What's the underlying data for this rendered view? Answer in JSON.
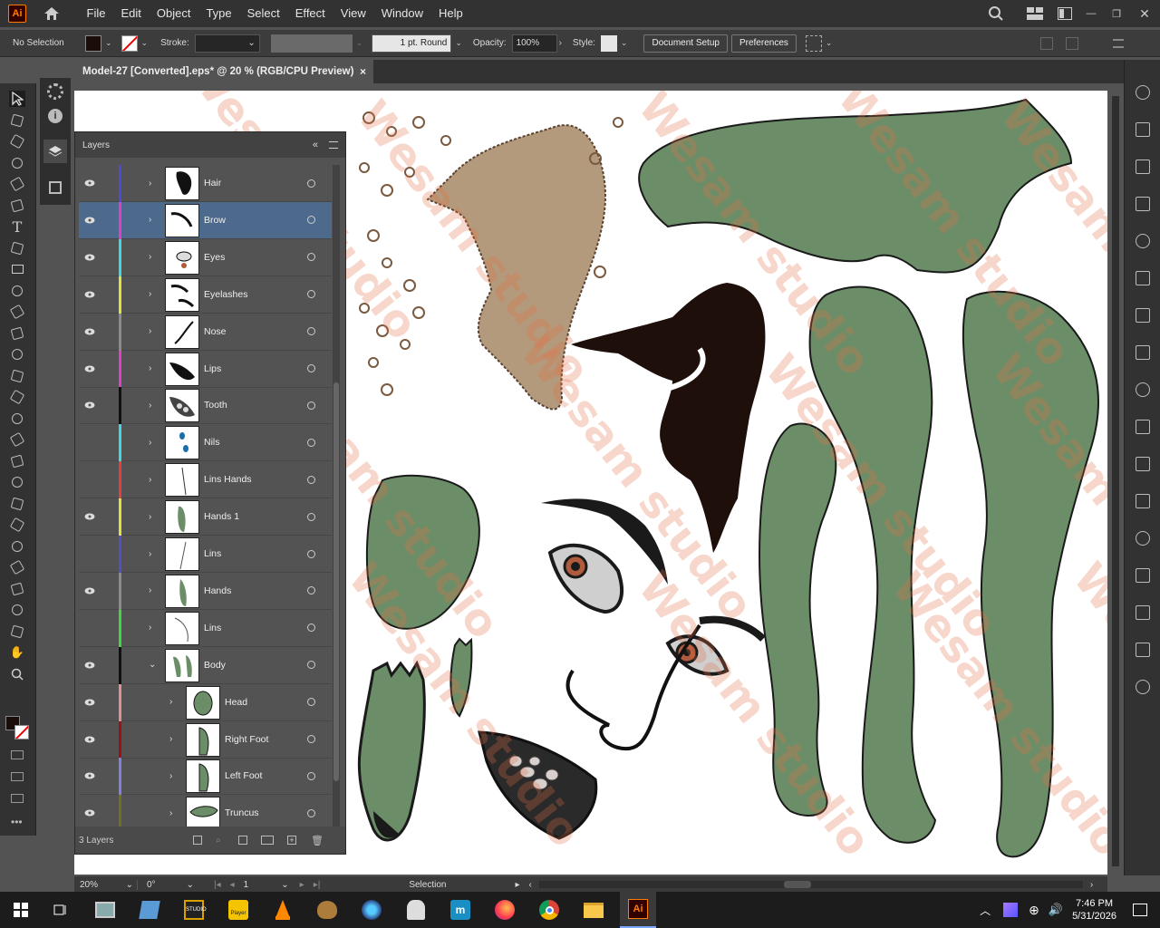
{
  "app": {
    "logo": "Ai"
  },
  "menu": [
    "File",
    "Edit",
    "Object",
    "Type",
    "Select",
    "Effect",
    "View",
    "Window",
    "Help"
  ],
  "control": {
    "selection": "No Selection",
    "stroke_label": "Stroke:",
    "brush": "1 pt. Round",
    "opacity_label": "Opacity:",
    "opacity_value": "100%",
    "style_label": "Style:",
    "doc_setup": "Document Setup",
    "preferences": "Preferences"
  },
  "document": {
    "tab_title": "Model-27 [Converted].eps* @ 20 % (RGB/CPU Preview)",
    "close": "×"
  },
  "layers_panel": {
    "title": "Layers",
    "footer_count": "3 Layers",
    "rows": [
      {
        "name": "Hair",
        "color": "#4a4adb",
        "eye": true
      },
      {
        "name": "Brow",
        "color": "#e040c8",
        "eye": true,
        "selected": true
      },
      {
        "name": "Eyes",
        "color": "#40d8e0",
        "eye": true
      },
      {
        "name": "Eyelashes",
        "color": "#e0e040",
        "eye": true
      },
      {
        "name": "Nose",
        "color": "#8a8a8a",
        "eye": true
      },
      {
        "name": "Lips",
        "color": "#e040c8",
        "eye": true
      },
      {
        "name": "Tooth",
        "color": "#111111",
        "eye": true
      },
      {
        "name": "Nils",
        "color": "#40d8e0",
        "eye": false
      },
      {
        "name": "Lins Hands",
        "color": "#e04040",
        "eye": false
      },
      {
        "name": "Hands 1",
        "color": "#e0e040",
        "eye": true
      },
      {
        "name": "Lins",
        "color": "#5050c8",
        "eye": false
      },
      {
        "name": "Hands",
        "color": "#8a8a8a",
        "eye": true
      },
      {
        "name": "Lins",
        "color": "#40d840",
        "eye": false
      },
      {
        "name": "Body",
        "color": "#111111",
        "eye": true,
        "expanded": true
      },
      {
        "name": "Head",
        "color": "#e09090",
        "eye": true,
        "sub": true
      },
      {
        "name": "Right Foot",
        "color": "#a01010",
        "eye": true,
        "sub": true
      },
      {
        "name": "Left Foot",
        "color": "#8080e0",
        "eye": true,
        "sub": true
      },
      {
        "name": "Truncus",
        "color": "#707020",
        "eye": true,
        "sub": true
      }
    ]
  },
  "status": {
    "zoom": "20%",
    "rotation": "0°",
    "artboard": "1",
    "tool": "Selection"
  },
  "taskbar": {
    "time": "7:46 PM",
    "date": "5/31/2026",
    "ai_label": "Ai"
  },
  "watermark": "Wesam studio",
  "colors": {
    "skin": "#6b8e68",
    "outline": "#1a1a1a",
    "hair": "#1e0f0a"
  }
}
